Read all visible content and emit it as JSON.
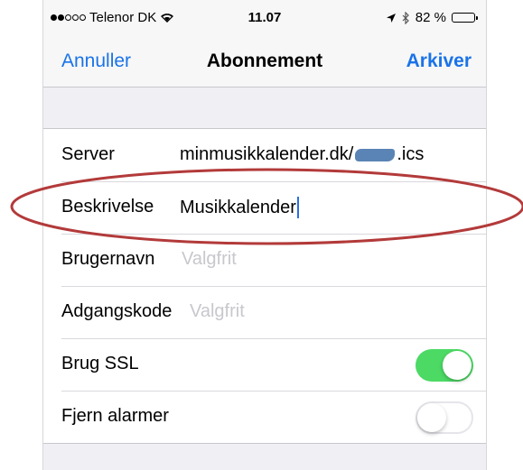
{
  "status_bar": {
    "carrier": "Telenor DK",
    "time": "11.07",
    "battery": "82 %",
    "battery_level": 0.82
  },
  "nav": {
    "cancel_label": "Annuller",
    "title": "Abonnement",
    "save_label": "Arkiver"
  },
  "rows": {
    "server": {
      "label": "Server",
      "value_prefix": "minmusikkalender.dk/",
      "value_suffix": ".ics"
    },
    "description": {
      "label": "Beskrivelse",
      "value": "Musikkalender"
    },
    "username": {
      "label": "Brugernavn",
      "placeholder": "Valgfrit"
    },
    "password": {
      "label": "Adgangskode",
      "placeholder": "Valgfrit"
    },
    "ssl": {
      "label": "Brug SSL",
      "enabled": true
    },
    "alarms": {
      "label": "Fjern alarmer",
      "enabled": false
    }
  },
  "colors": {
    "accent": "#1a73e8",
    "toggle_on": "#4cd964",
    "annotation": "#b33a3a"
  }
}
